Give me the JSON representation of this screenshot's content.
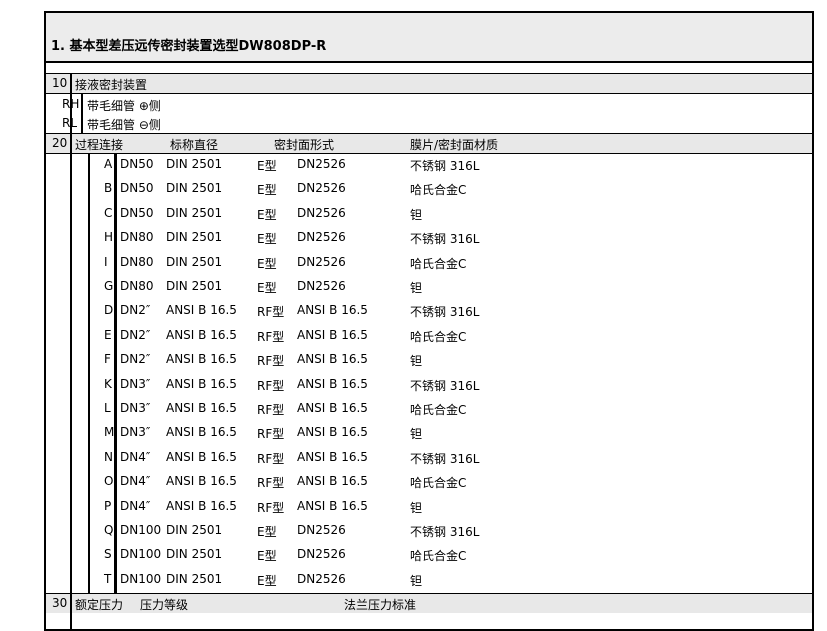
{
  "title": "1. 基本型差压远传密封装置选型DW808DP-R",
  "section10": {
    "code": "10",
    "label": "接液密封装置",
    "items": [
      {
        "code": "RH",
        "text": "带毛细管 ⊕侧"
      },
      {
        "code": "RL",
        "text": "带毛细管 ⊖侧"
      }
    ]
  },
  "section20": {
    "code": "20",
    "headers": [
      "过程连接",
      "标称直径",
      "密封面形式",
      "膜片/密封面材质"
    ],
    "rows": [
      {
        "code": "A",
        "dn": "DN50",
        "std": "DIN 2501",
        "form": "E型",
        "face": "DN2526",
        "mat": "不锈钢 316L"
      },
      {
        "code": "B",
        "dn": "DN50",
        "std": "DIN 2501",
        "form": "E型",
        "face": "DN2526",
        "mat": "哈氏合金C"
      },
      {
        "code": "C",
        "dn": "DN50",
        "std": "DIN 2501",
        "form": "E型",
        "face": "DN2526",
        "mat": "钽"
      },
      {
        "code": "H",
        "dn": "DN80",
        "std": "DIN 2501",
        "form": "E型",
        "face": "DN2526",
        "mat": "不锈钢 316L"
      },
      {
        "code": "I",
        "dn": "DN80",
        "std": "DIN 2501",
        "form": "E型",
        "face": "DN2526",
        "mat": "哈氏合金C"
      },
      {
        "code": "G",
        "dn": "DN80",
        "std": "DIN 2501",
        "form": "E型",
        "face": "DN2526",
        "mat": "钽"
      },
      {
        "code": "D",
        "dn": "DN2″",
        "std": "ANSI B 16.5",
        "form": "RF型",
        "face": "ANSI B 16.5",
        "mat": "不锈钢 316L"
      },
      {
        "code": "E",
        "dn": "DN2″",
        "std": "ANSI B 16.5",
        "form": "RF型",
        "face": "ANSI B 16.5",
        "mat": "哈氏合金C"
      },
      {
        "code": "F",
        "dn": "DN2″",
        "std": "ANSI B 16.5",
        "form": "RF型",
        "face": "ANSI B 16.5",
        "mat": "钽"
      },
      {
        "code": "K",
        "dn": "DN3″",
        "std": "ANSI B 16.5",
        "form": "RF型",
        "face": "ANSI B 16.5",
        "mat": "不锈钢 316L"
      },
      {
        "code": "L",
        "dn": "DN3″",
        "std": "ANSI B 16.5",
        "form": "RF型",
        "face": "ANSI B 16.5",
        "mat": "哈氏合金C"
      },
      {
        "code": "M",
        "dn": "DN3″",
        "std": "ANSI B 16.5",
        "form": "RF型",
        "face": "ANSI B 16.5",
        "mat": "钽"
      },
      {
        "code": "N",
        "dn": "DN4″",
        "std": "ANSI B 16.5",
        "form": "RF型",
        "face": "ANSI B 16.5",
        "mat": "不锈钢 316L"
      },
      {
        "code": "O",
        "dn": "DN4″",
        "std": "ANSI B 16.5",
        "form": "RF型",
        "face": "ANSI B 16.5",
        "mat": "哈氏合金C"
      },
      {
        "code": "P",
        "dn": "DN4″",
        "std": "ANSI B 16.5",
        "form": "RF型",
        "face": "ANSI B 16.5",
        "mat": "钽"
      },
      {
        "code": "Q",
        "dn": "DN100",
        "std": "DIN 2501",
        "form": "E型",
        "face": "DN2526",
        "mat": "不锈钢 316L"
      },
      {
        "code": "S",
        "dn": "DN100",
        "std": "DIN 2501",
        "form": "E型",
        "face": "DN2526",
        "mat": "哈氏合金C"
      },
      {
        "code": "T",
        "dn": "DN100",
        "std": "DIN 2501",
        "form": "E型",
        "face": "DN2526",
        "mat": "钽"
      }
    ]
  },
  "section30": {
    "code": "30",
    "headers": [
      "额定压力",
      "压力等级",
      "法兰压力标准"
    ]
  }
}
